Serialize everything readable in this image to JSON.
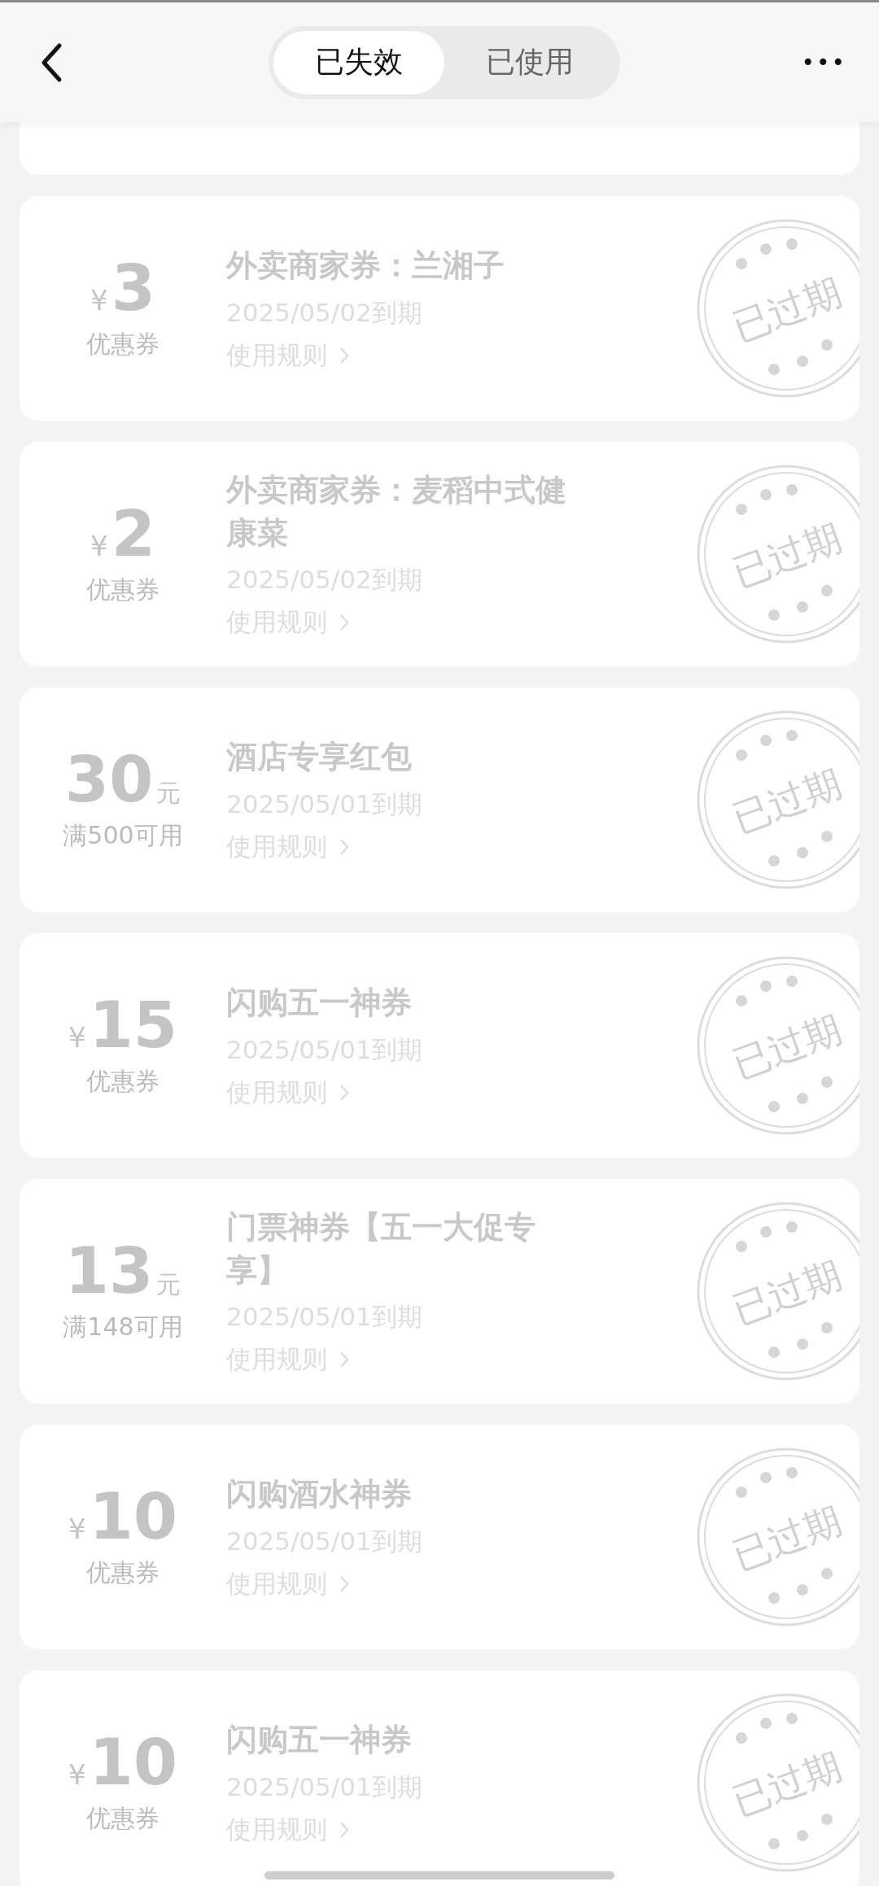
{
  "header": {
    "tabs": [
      {
        "label": "已失效",
        "selected": true
      },
      {
        "label": "已使用",
        "selected": false
      }
    ],
    "more": "•••"
  },
  "coupons": [
    {
      "kind": "prefix",
      "unit": "¥",
      "amount": "3",
      "note": "优惠券",
      "title": "外卖商家券：兰湘子",
      "expiry": "2025/05/02到期",
      "rules": "使用规则",
      "stamp": "已过期"
    },
    {
      "kind": "prefix",
      "unit": "¥",
      "amount": "2",
      "note": "优惠券",
      "title": "外卖商家券：麦稻中式健康菜",
      "expiry": "2025/05/02到期",
      "rules": "使用规则",
      "stamp": "已过期"
    },
    {
      "kind": "suffix",
      "unit": "元",
      "amount": "30",
      "note": "满500可用",
      "title": "酒店专享红包",
      "expiry": "2025/05/01到期",
      "rules": "使用规则",
      "stamp": "已过期"
    },
    {
      "kind": "prefix",
      "unit": "¥",
      "amount": "15",
      "note": "优惠券",
      "title": "闪购五一神券",
      "expiry": "2025/05/01到期",
      "rules": "使用规则",
      "stamp": "已过期"
    },
    {
      "kind": "suffix",
      "unit": "元",
      "amount": "13",
      "note": "满148可用",
      "title": "门票神券【五一大促专享】",
      "expiry": "2025/05/01到期",
      "rules": "使用规则",
      "stamp": "已过期"
    },
    {
      "kind": "prefix",
      "unit": "¥",
      "amount": "10",
      "note": "优惠券",
      "title": "闪购酒水神券",
      "expiry": "2025/05/01到期",
      "rules": "使用规则",
      "stamp": "已过期"
    },
    {
      "kind": "prefix",
      "unit": "¥",
      "amount": "10",
      "note": "优惠券",
      "title": "闪购五一神券",
      "expiry": "2025/05/01到期",
      "rules": "使用规则",
      "stamp": "已过期"
    }
  ]
}
